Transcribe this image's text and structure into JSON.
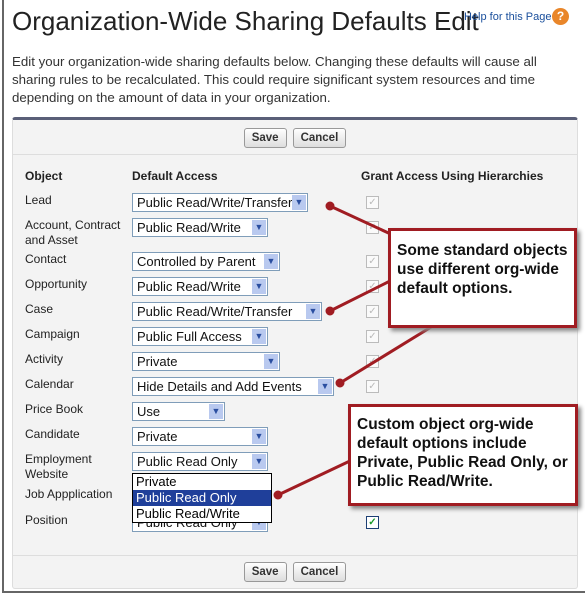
{
  "title": "Organization-Wide Sharing Defaults Edit",
  "help_link": "Help for this Page",
  "intro": "Edit your organization-wide sharing defaults below. Changing these defaults will cause all sharing rules to be recalculated. This could require significant system resources and time depending on the amount of data in your organization.",
  "buttons": {
    "save": "Save",
    "cancel": "Cancel"
  },
  "headers": {
    "object": "Object",
    "access": "Default Access",
    "grant": "Grant Access Using Hierarchies"
  },
  "rows": [
    {
      "object": "Lead",
      "access": "Public Read/Write/Transfer",
      "grant": true
    },
    {
      "object": "Account, Contract and Asset",
      "access": "Public Read/Write",
      "grant": true
    },
    {
      "object": "Contact",
      "access": "Controlled by Parent",
      "grant": true
    },
    {
      "object": "Opportunity",
      "access": "Public Read/Write",
      "grant": true
    },
    {
      "object": "Case",
      "access": "Public Read/Write/Transfer",
      "grant": true
    },
    {
      "object": "Campaign",
      "access": "Public Full Access",
      "grant": true
    },
    {
      "object": "Activity",
      "access": "Private",
      "grant": true
    },
    {
      "object": "Calendar",
      "access": "Hide Details and Add Events",
      "grant": true
    },
    {
      "object": "Price Book",
      "access": "Use"
    },
    {
      "object": "Candidate",
      "access": "Private"
    },
    {
      "object": "Employment Website",
      "access": "Public Read Only"
    },
    {
      "object": "Job Appplication",
      "access": ""
    },
    {
      "object": "Position",
      "access": "Public Read Only",
      "grant": true
    }
  ],
  "dropdown_options": [
    "Private",
    "Public Read Only",
    "Public Read/Write"
  ],
  "dropdown_selected": "Public Read Only",
  "callouts": [
    "Some standard objects use different org-wide default options.",
    "Custom object org-wide default options include Private, Public Read Only, or Public Read/Write."
  ],
  "colors": {
    "callout_border": "#a01c22",
    "highlight": "#1f3f9a"
  }
}
